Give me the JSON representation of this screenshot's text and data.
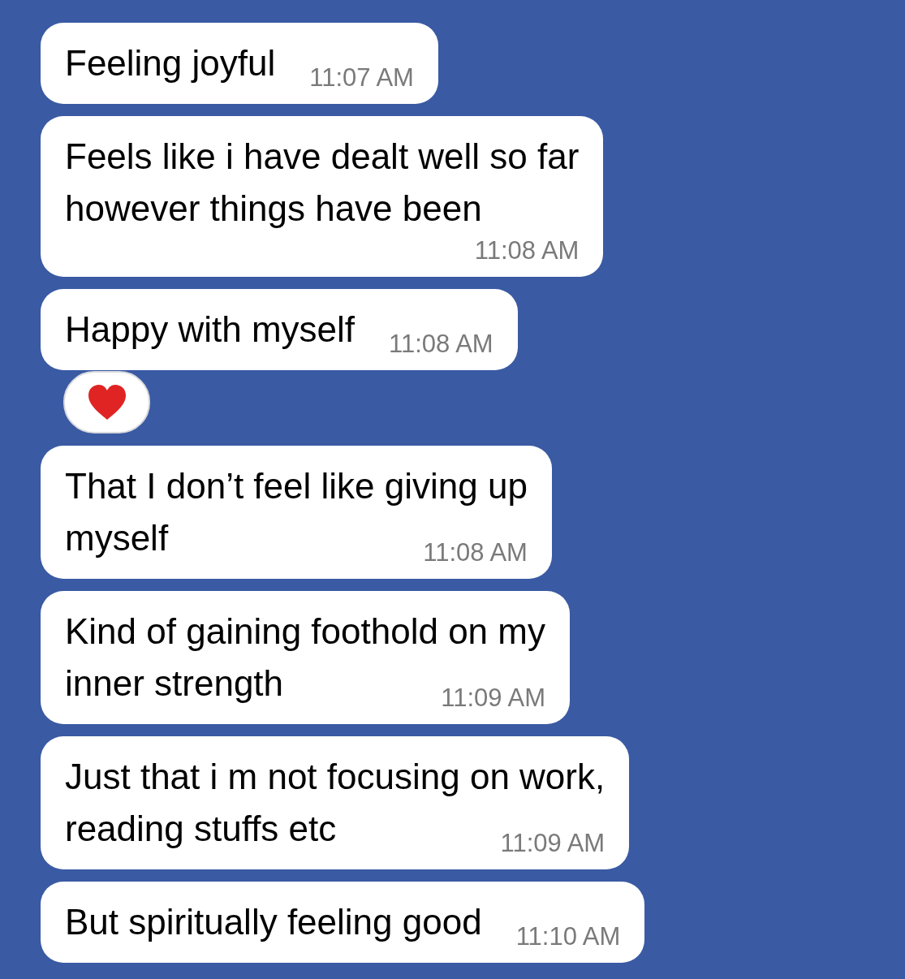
{
  "messages": [
    {
      "lines": [
        "Feeling joyful"
      ],
      "time": "11:07 AM",
      "reacted": false
    },
    {
      "lines": [
        "Feels like i have dealt well so far",
        "however things have been"
      ],
      "time": "11:08 AM",
      "reacted": false
    },
    {
      "lines": [
        "Happy with myself"
      ],
      "time": "11:08 AM",
      "reacted": true
    },
    {
      "lines": [
        "That I don’t feel like giving up",
        "myself"
      ],
      "time": "11:08 AM",
      "reacted": false
    },
    {
      "lines": [
        "Kind of gaining foothold on my",
        "inner strength"
      ],
      "time": "11:09 AM",
      "reacted": false
    },
    {
      "lines": [
        "Just that i m not focusing on work,",
        "reading stuffs etc"
      ],
      "time": "11:09 AM",
      "reacted": false
    },
    {
      "lines": [
        "But spiritually feeling good"
      ],
      "time": "11:10 AM",
      "reacted": false
    }
  ]
}
